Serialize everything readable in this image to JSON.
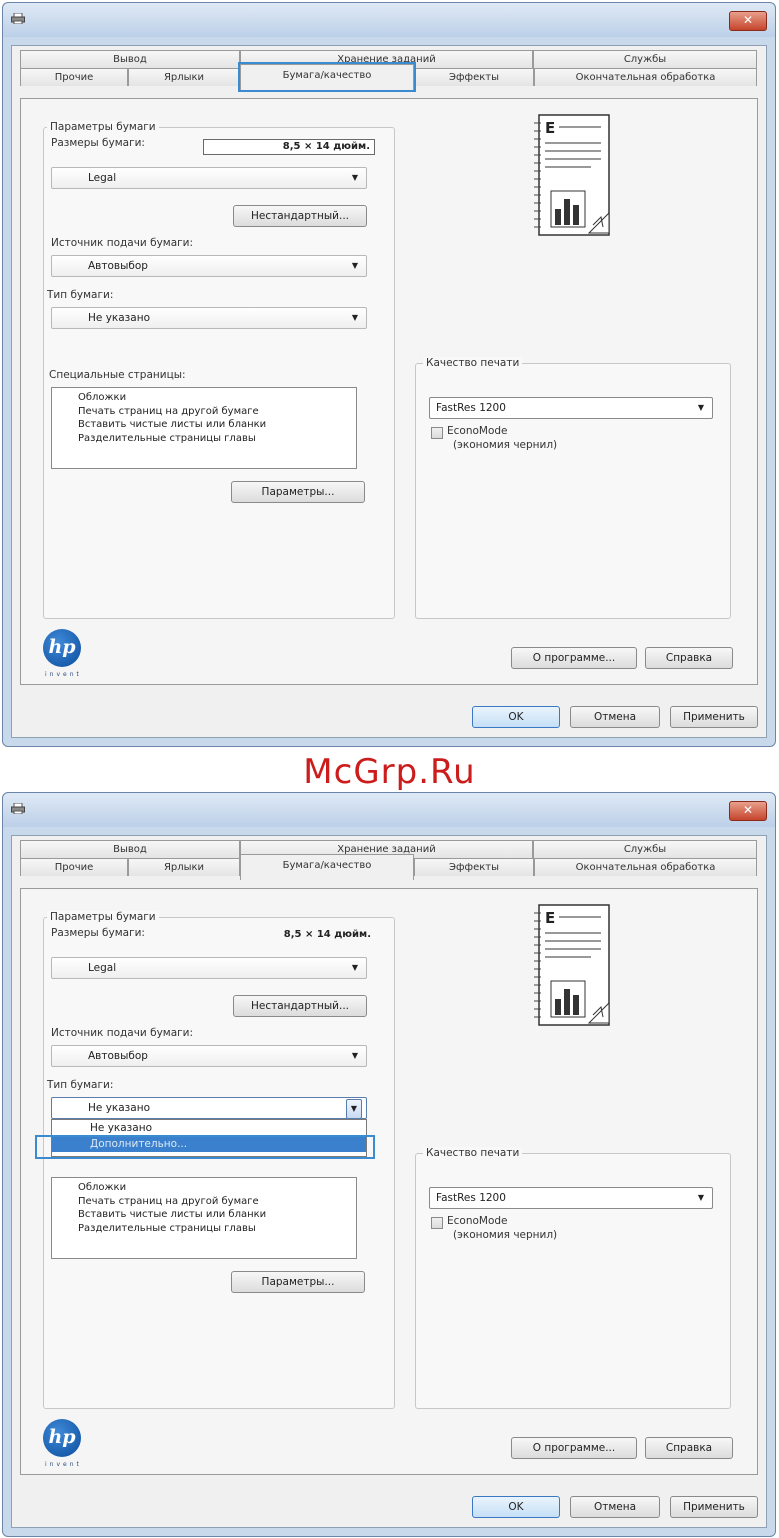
{
  "watermark": "McGrp.Ru",
  "dialog": {
    "close_glyph": "✕",
    "tabs_row1": [
      "Вывод",
      "Хранение заданий",
      "Службы"
    ],
    "tabs_row2": [
      "Прочие",
      "Ярлыки",
      "Бумага/качество",
      "Эффекты",
      "Окончательная обработка"
    ],
    "active_tab": "Бумага/качество",
    "paper_group_label": "Параметры бумаги",
    "paper_size_label": "Размеры бумаги:",
    "paper_size_value": "8,5 × 14 дюйм.",
    "paper_size_combo": "Legal",
    "custom_button": "Нестандартный...",
    "source_label": "Источник подачи бумаги:",
    "source_value": "Автовыбор",
    "type_label": "Тип бумаги:",
    "type_value": "Не указано",
    "special_pages_label": "Специальные страницы:",
    "special_pages_items": [
      "Обложки",
      "Печать страниц на другой бумаге",
      "Вставить чистые листы или бланки",
      "Разделительные страницы главы"
    ],
    "params_button": "Параметры...",
    "quality_group_label": "Качество печати",
    "quality_value": "FastRes 1200",
    "economode_label": "EconoMode",
    "economode_sub": "(экономия чернил)",
    "about_button": "О программе...",
    "help_button": "Справка",
    "ok_button": "OK",
    "cancel_button": "Отмена",
    "apply_button": "Применить",
    "logo_text": "hp",
    "logo_tag": "invent",
    "type_dropdown_options": [
      "Не указано",
      "Дополнительно..."
    ]
  },
  "colors": {
    "highlight": "#3b8bd0",
    "watermark": "#cc1d1d",
    "selection": "#3a80cc"
  },
  "icons": [
    "printer-icon",
    "close-icon",
    "page-preview-icon",
    "hp-logo",
    "dropdown-arrow-icon"
  ]
}
